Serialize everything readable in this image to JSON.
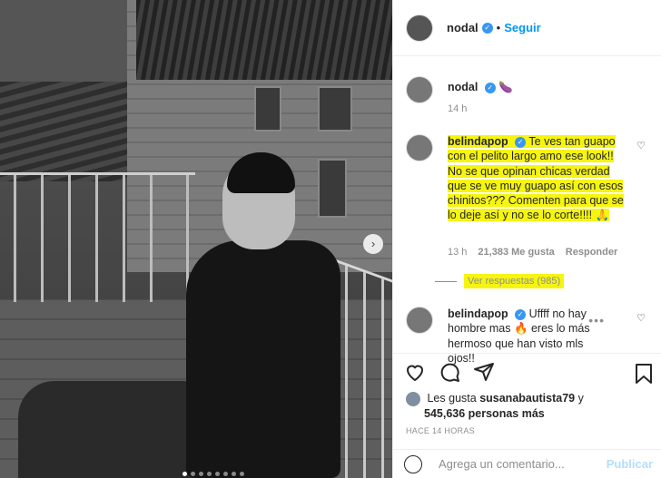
{
  "header": {
    "username": "nodal",
    "follow_label": "Seguir"
  },
  "caption": {
    "username": "nodal",
    "emoji": "🍆",
    "time": "14 h"
  },
  "comments": [
    {
      "username": "belindapop",
      "text": "Te ves tan guapo con el pelito largo amo ese look!! No se que opinan chicas verdad que se ve muy guapo así con esos chinitos??? Comenten para que se lo deje así y no se lo corte!!!! 🙏",
      "time": "13 h",
      "likes": "21,383 Me gusta",
      "reply_label": "Responder",
      "view_replies": "Ver respuestas (985)"
    },
    {
      "username": "belindapop",
      "text": "Uffff no hay hombre mas 🔥 eres lo más hermoso que han visto mls ojos!!"
    }
  ],
  "likes_text": {
    "prefix": "Les gusta",
    "user": "susanabautista79",
    "conj": "y",
    "count": "545,636 personas más"
  },
  "timestamp": "HACE 14 HORAS",
  "add_comment": {
    "placeholder": "Agrega un comentario...",
    "publish": "Publicar"
  },
  "icons": [
    "heart-icon",
    "comment-icon",
    "share-icon",
    "bookmark-icon",
    "emoji-icon",
    "verified-icon",
    "chevron-right-icon"
  ],
  "colors": {
    "link": "#0095f6",
    "verified": "#3897f0",
    "highlight": "#f6f510"
  }
}
